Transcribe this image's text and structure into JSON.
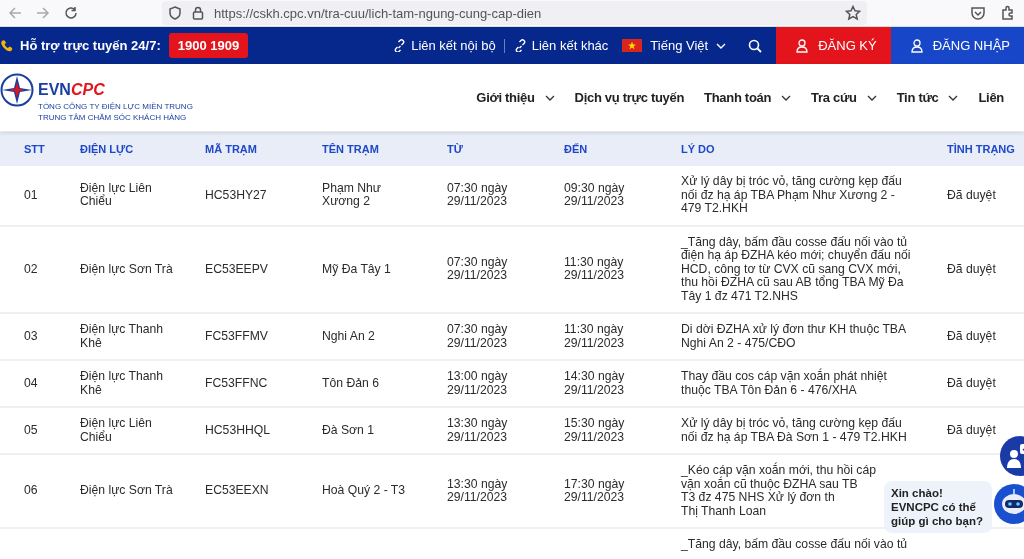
{
  "browser": {
    "url": "https://cskh.cpc.vn/tra-cuu/lich-tam-ngung-cung-cap-dien"
  },
  "topbar": {
    "support_label": "Hỗ trợ trực tuyến 24/7:",
    "hotline": "1900 1909",
    "links": [
      "Liên kết nội bộ",
      "Liên kết khác"
    ],
    "language": "Tiếng Việt",
    "register": "ĐĂNG KÝ",
    "login": "ĐĂNG NHẬP"
  },
  "header": {
    "logo": {
      "brand": "EVN",
      "brand_accent": "CPC",
      "line_1": "TỔNG CÔNG TY ĐIỆN LỰC MIỀN TRUNG",
      "line_2": "TRUNG TÂM CHĂM SÓC KHÁCH HÀNG"
    },
    "nav": [
      {
        "label": "Giới thiệu",
        "dropdown": true
      },
      {
        "label": "Dịch vụ trực tuyến",
        "dropdown": false
      },
      {
        "label": "Thanh toán",
        "dropdown": true
      },
      {
        "label": "Tra cứu",
        "dropdown": true
      },
      {
        "label": "Tin tức",
        "dropdown": true
      },
      {
        "label": "Liên",
        "dropdown": false
      }
    ]
  },
  "table": {
    "columns": [
      "STT",
      "ĐIỆN LỰC",
      "MÃ TRẠM",
      "TÊN TRẠM",
      "TỪ",
      "ĐẾN",
      "LÝ DO",
      "TÌNH TRẠNG"
    ],
    "rows": [
      {
        "stt": "01",
        "unit": "Điện lực Liên Chiểu",
        "code": "HC53HY27",
        "station": "Phạm Như Xương 2",
        "from": "07:30 ngày 29/11/2023",
        "to": "09:30 ngày 29/11/2023",
        "reason": "Xử lý dây bị tróc vỏ, tăng cường kẹp đấu nối đz hạ áp TBA Phạm Như Xương 2 - 479 T2.HKH",
        "status": "Đã duyệt"
      },
      {
        "stt": "02",
        "unit": "Điện lực Sơn Trà",
        "code": "EC53EEPV",
        "station": "Mỹ Đa Tây 1",
        "from": "07:30 ngày 29/11/2023",
        "to": "11:30 ngày 29/11/2023",
        "reason": "_Tăng dây, bấm đầu cosse đấu nối vào tủ điện hạ áp ĐZHA kéo mới; chuyển đấu nối HCD, công tơ từ CVX cũ sang CVX mới, thu hồi ĐZHA cũ sau AB tổng TBA Mỹ Đa Tây 1 đz 471 T2.NHS",
        "status": "Đã duyệt"
      },
      {
        "stt": "03",
        "unit": "Điện lực Thanh Khê",
        "code": "FC53FFMV",
        "station": "Nghi An 2",
        "from": "07:30 ngày 29/11/2023",
        "to": "11:30 ngày 29/11/2023",
        "reason": "Di dời ĐZHA xử lý đơn thư KH thuộc TBA Nghi An 2 - 475/CĐO",
        "status": "Đã duyệt"
      },
      {
        "stt": "04",
        "unit": "Điện lực Thanh Khê",
        "code": "FC53FFNC",
        "station": "Tôn Đản 6",
        "from": "13:00 ngày 29/11/2023",
        "to": "14:30 ngày 29/11/2023",
        "reason": "Thay đầu cos cáp vặn xoắn phát nhiệt thuộc TBA Tôn Đản 6 - 476/XHA",
        "status": "Đã duyệt"
      },
      {
        "stt": "05",
        "unit": "Điện lực Liên Chiểu",
        "code": "HC53HHQL",
        "station": "Đà Sơn 1",
        "from": "13:30 ngày 29/11/2023",
        "to": "15:30 ngày 29/11/2023",
        "reason": "Xử lý dây bị tróc vỏ, tăng cường kẹp đấu nối đz hạ áp TBA Đà Sơn 1 - 479 T2.HKH",
        "status": "Đã duyệt"
      },
      {
        "stt": "06",
        "unit": "Điện lực Sơn Trà",
        "code": "EC53EEXN",
        "station": "Hoà Quý 2 - T3",
        "from": "13:30 ngày 29/11/2023",
        "to": "17:30 ngày 29/11/2023",
        "reason": "_Kéo cáp vặn xoắn mới, thu hồi cáp\nvặn xoắn cũ thuộc ĐZHA sau TB\nT3 đz 475 NHS Xử lý đơn th\nThị Thanh Loan"
      },
      {
        "reason": "_Tăng dây, bấm đầu cosse đấu nối vào tủ"
      }
    ]
  },
  "chat": {
    "greeting": "Xin chào! EVNCPC có thể giúp gì cho bạn?"
  }
}
